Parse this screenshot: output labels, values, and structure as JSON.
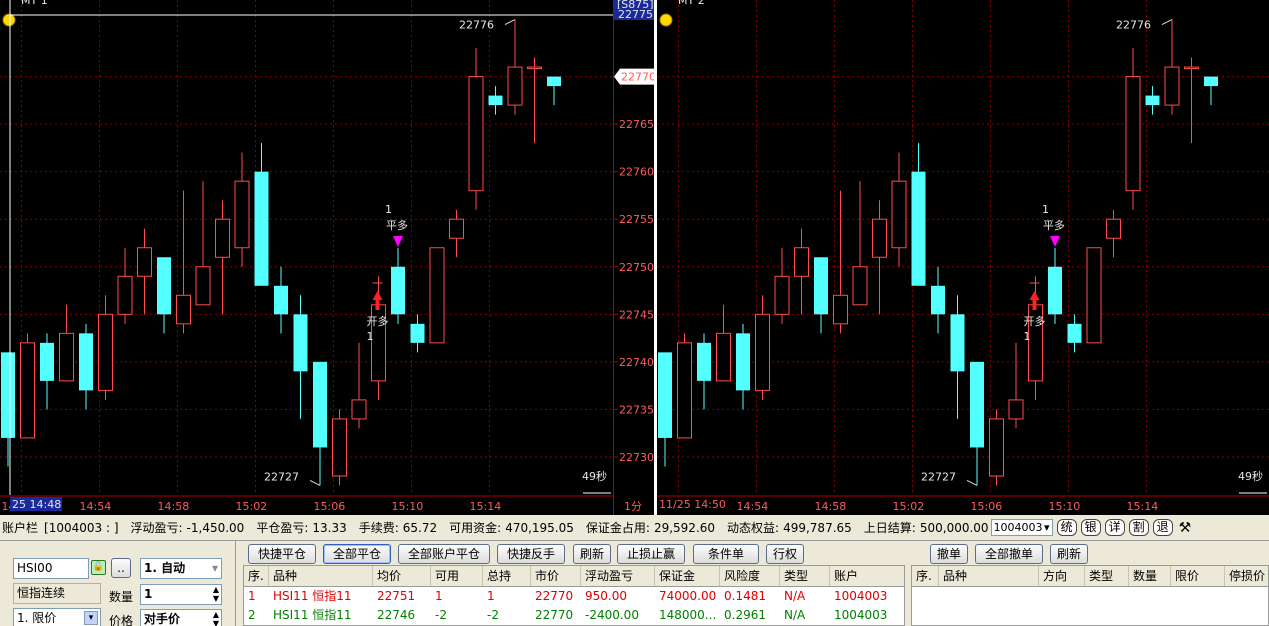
{
  "chart1": {
    "title": "MT 1",
    "high_label": "22776",
    "low_label": "22727",
    "countdown": "49秒",
    "cursor_time": "25 14:48",
    "cursor_price": "22775",
    "top_badge": "[S875]",
    "current_price": "22770",
    "period": "1分",
    "order_label_top": "1",
    "order_label_ping": "平多",
    "order_label_open": "开多",
    "order_label_qty": "1"
  },
  "chart2": {
    "title": "MT 2",
    "high_label": "22776",
    "low_label": "22727",
    "countdown": "49秒",
    "first_time": "11/25 14:50",
    "order_label_top": "1",
    "order_label_ping": "平多",
    "order_label_open": "开多",
    "order_label_qty": "1"
  },
  "time_labels": [
    "14:50",
    "14:54",
    "14:58",
    "15:02",
    "15:06",
    "15:10",
    "15:14"
  ],
  "price_ticks": [
    "22770",
    "22765",
    "22760",
    "22755",
    "22750",
    "22745",
    "22740",
    "22735",
    "22730"
  ],
  "colors": {
    "up": "#ff4b4b",
    "down": "#54ffff",
    "grid": "#8a0000",
    "axis": "#ff5b5b"
  },
  "chart_data": {
    "type": "candlestick",
    "price_range": [
      22726,
      22777
    ],
    "candles": [
      {
        "o": 22741,
        "h": 22741,
        "l": 22729,
        "c": 22732
      },
      {
        "o": 22732,
        "h": 22743,
        "l": 22732,
        "c": 22742
      },
      {
        "o": 22742,
        "h": 22743,
        "l": 22735,
        "c": 22738
      },
      {
        "o": 22738,
        "h": 22746,
        "l": 22738,
        "c": 22743
      },
      {
        "o": 22743,
        "h": 22744,
        "l": 22735,
        "c": 22737
      },
      {
        "o": 22737,
        "h": 22747,
        "l": 22736,
        "c": 22745
      },
      {
        "o": 22745,
        "h": 22752,
        "l": 22744,
        "c": 22749
      },
      {
        "o": 22749,
        "h": 22754,
        "l": 22745,
        "c": 22752
      },
      {
        "o": 22751,
        "h": 22751,
        "l": 22743,
        "c": 22745
      },
      {
        "o": 22744,
        "h": 22758,
        "l": 22743,
        "c": 22747
      },
      {
        "o": 22746,
        "h": 22759,
        "l": 22746,
        "c": 22750
      },
      {
        "o": 22751,
        "h": 22757,
        "l": 22745,
        "c": 22755
      },
      {
        "o": 22752,
        "h": 22762,
        "l": 22750,
        "c": 22759
      },
      {
        "o": 22760,
        "h": 22763,
        "l": 22750,
        "c": 22748
      },
      {
        "o": 22748,
        "h": 22750,
        "l": 22743,
        "c": 22745
      },
      {
        "o": 22745,
        "h": 22747,
        "l": 22734,
        "c": 22739
      },
      {
        "o": 22740,
        "h": 22740,
        "l": 22727,
        "c": 22731
      },
      {
        "o": 22728,
        "h": 22735,
        "l": 22727,
        "c": 22734
      },
      {
        "o": 22734,
        "h": 22742,
        "l": 22733,
        "c": 22736
      },
      {
        "o": 22738,
        "h": 22749,
        "l": 22736,
        "c": 22746
      },
      {
        "o": 22750,
        "h": 22752,
        "l": 22744,
        "c": 22745
      },
      {
        "o": 22744,
        "h": 22745,
        "l": 22741,
        "c": 22742
      },
      {
        "o": 22742,
        "h": 22752,
        "l": 22742,
        "c": 22752
      },
      {
        "o": 22753,
        "h": 22756,
        "l": 22751,
        "c": 22755
      },
      {
        "o": 22758,
        "h": 22773,
        "l": 22756,
        "c": 22770
      },
      {
        "o": 22768,
        "h": 22769,
        "l": 22766,
        "c": 22767
      },
      {
        "o": 22767,
        "h": 22776,
        "l": 22766,
        "c": 22771
      },
      {
        "o": 22771,
        "h": 22772,
        "l": 22763,
        "c": 22771
      },
      {
        "o": 22770,
        "h": 22770,
        "l": 22767,
        "c": 22769
      }
    ]
  },
  "account_bar": {
    "label": "账户栏",
    "account_id": "[1004003 : ]",
    "float_pnl_label": "浮动盈亏:",
    "float_pnl": "-1,450.00",
    "close_pnl_label": "平仓盈亏:",
    "close_pnl": "13.33",
    "fee_label": "手续费:",
    "fee": "65.72",
    "avail_label": "可用资金:",
    "avail": "470,195.05",
    "margin_label": "保证金占用:",
    "margin": "29,592.60",
    "equity_label": "动态权益:",
    "equity": "499,787.65",
    "settle_label": "上日结算:",
    "settle": "500,000.00",
    "account_select": "1004003",
    "btns": [
      "统",
      "银",
      "详",
      "割",
      "退"
    ]
  },
  "order_panel": {
    "symbol": "HSI00",
    "contract": "恒指连续",
    "mode": "1. 自动",
    "qty_label": "数量",
    "qty": "1",
    "price_type": "1. 限价",
    "price_label": "价格",
    "price": "对手价",
    "more_btn": ".."
  },
  "action_buttons": [
    "快捷平仓",
    "全部平仓",
    "全部账户平仓",
    "快捷反手",
    "刷新",
    "止损止赢",
    "条件单",
    "行权"
  ],
  "right_buttons": [
    "撤单",
    "全部撤单",
    "刷新"
  ],
  "positions": {
    "headers": [
      "序.",
      "品种",
      "均价",
      "可用",
      "总持",
      "市价",
      "浮动盈亏",
      "保证金",
      "风险度",
      "类型",
      "账户"
    ],
    "rows": [
      [
        "1",
        "HSI11 恒指11",
        "22751",
        "1",
        "1",
        "22770",
        "950.00",
        "74000.00",
        "0.1481",
        "N/A",
        "1004003"
      ],
      [
        "2",
        "HSI11 恒指11",
        "22746",
        "-2",
        "-2",
        "22770",
        "-2400.00",
        "148000...",
        "0.2961",
        "N/A",
        "1004003"
      ]
    ]
  },
  "orders": {
    "headers": [
      "序.",
      "品种",
      "方向",
      "类型",
      "数量",
      "限价",
      "停损价"
    ]
  }
}
